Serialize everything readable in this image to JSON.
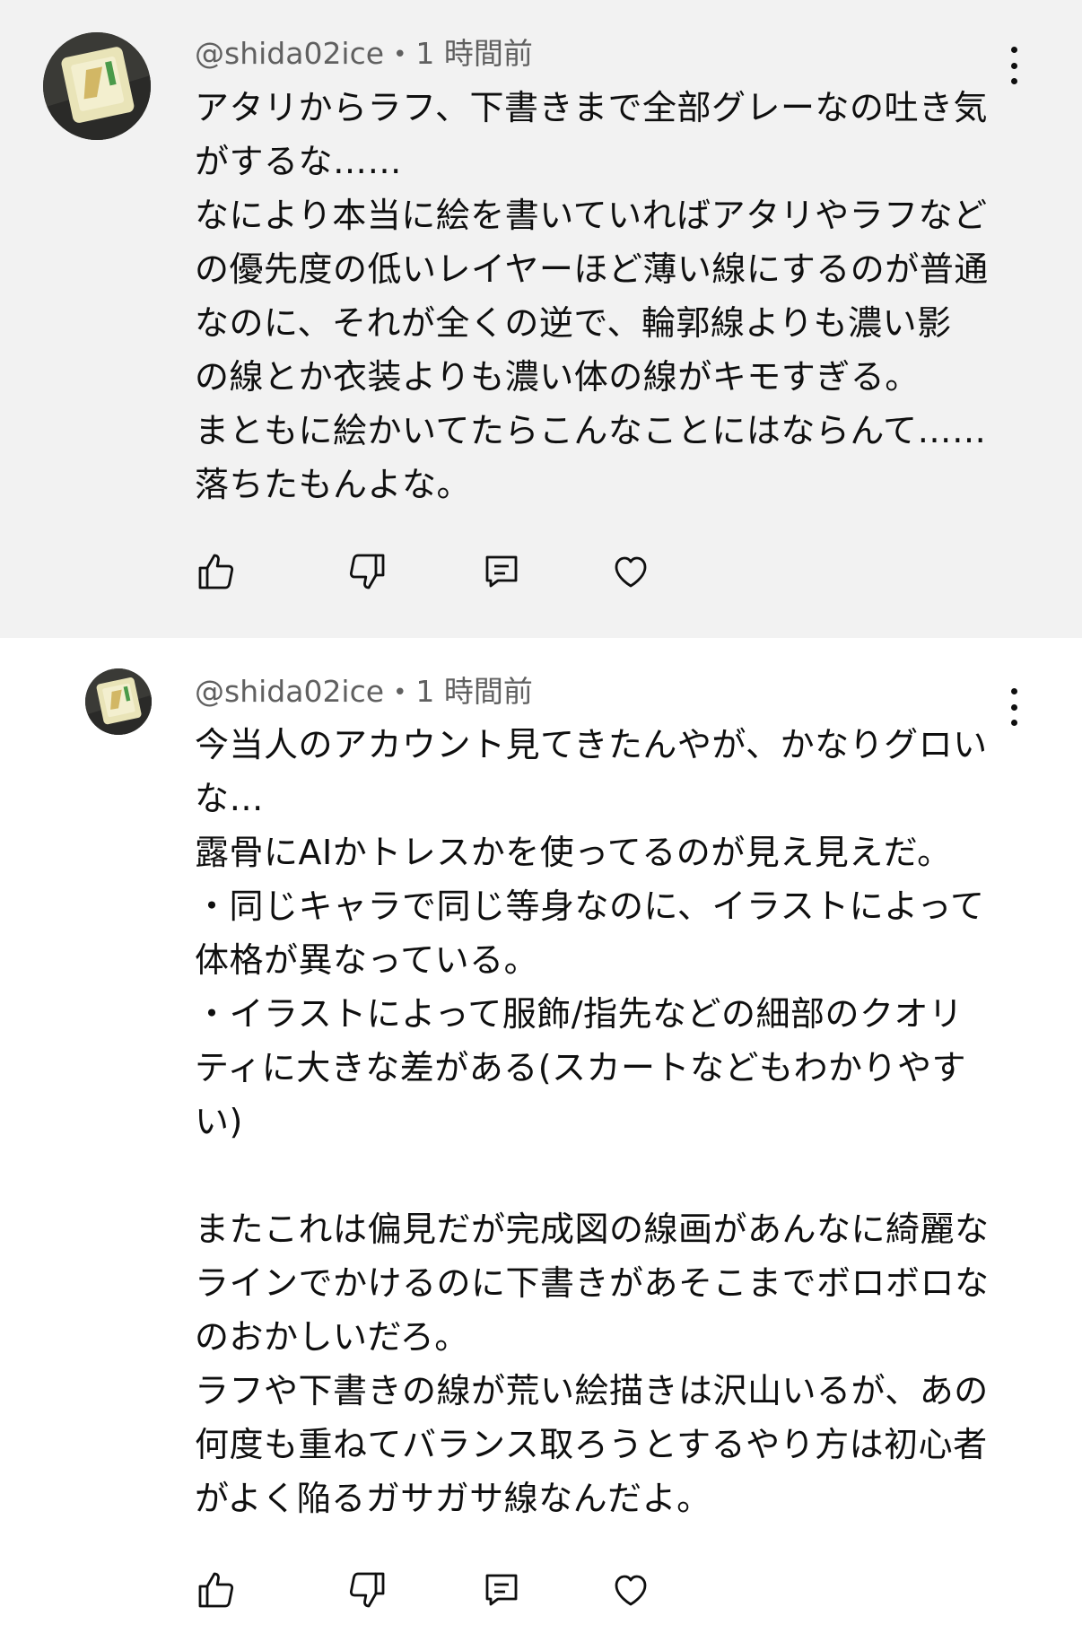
{
  "comments": [
    {
      "author": "@shida02ice",
      "separator": "•",
      "time": "1 時間前",
      "avatar_icon": "avatar-thumbnail",
      "menu_icon": "more-vertical-icon",
      "body": "アタリからラフ、下書きまで全部グレーなの吐き気\nがするな……\nなにより本当に絵を書いていればアタリやラフなど\nの優先度の低いレイヤーほど薄い線にするのが普通\nなのに、それが全くの逆で、輪郭線よりも濃い影\nの線とか衣装よりも濃い体の線がキモすぎる。\nまともに絵かいてたらこんなことにはならんて……\n落ちたもんよな。",
      "actions": [
        "thumbs-up-icon",
        "thumbs-down-icon",
        "reply-icon",
        "heart-icon"
      ]
    },
    {
      "author": "@shida02ice",
      "separator": "•",
      "time": "1 時間前",
      "avatar_icon": "avatar-thumbnail",
      "menu_icon": "more-vertical-icon",
      "body": "今当人のアカウント見てきたんやが、かなりグロい\nな…\n露骨にAIかトレスかを使ってるのが見え見えだ。\n・同じキャラで同じ等身なのに、イラストによって\n体格が異なっている。\n・イラストによって服飾/指先などの細部のクオリ\nティに大きな差がある(スカートなどもわかりやす\nい)\n\nまたこれは偏見だが完成図の線画があんなに綺麗な\nラインでかけるのに下書きがあそこまでボロボロな\nのおかしいだろ。\nラフや下書きの線が荒い絵描きは沢山いるが、あの\n何度も重ねてバランス取ろうとするやり方は初心者\nがよく陥るガサガサ線なんだよ。",
      "actions": [
        "thumbs-up-icon",
        "thumbs-down-icon",
        "reply-icon",
        "heart-icon"
      ]
    }
  ],
  "colors": {
    "highlight_background": "#f2f2f2",
    "background": "#ffffff",
    "text": "#0f0f0f",
    "meta_text": "#606060"
  }
}
